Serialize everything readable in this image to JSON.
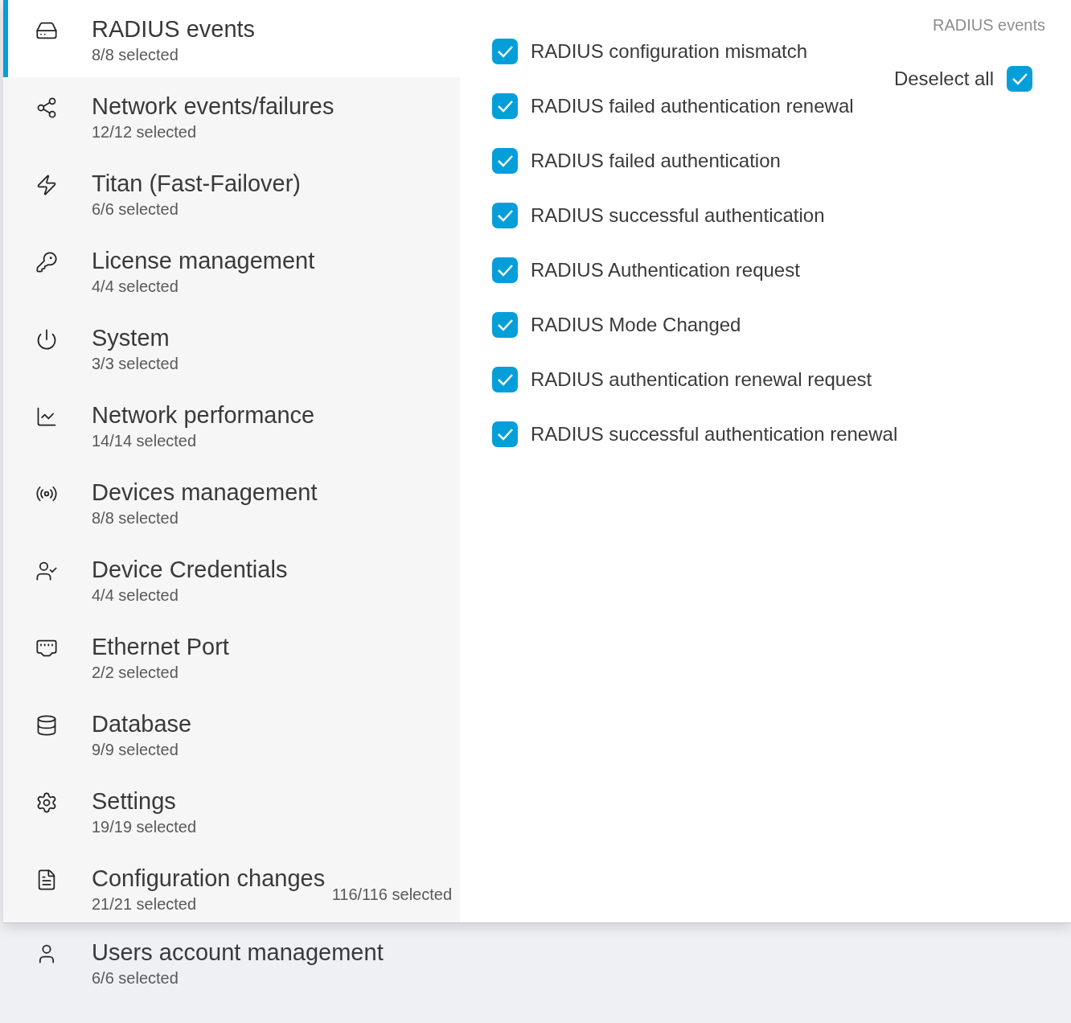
{
  "categories": [
    {
      "label": "RADIUS events",
      "count": "8/8 selected",
      "selected": true
    },
    {
      "label": "Network events/failures",
      "count": "12/12 selected",
      "selected": false
    },
    {
      "label": "Titan (Fast-Failover)",
      "count": "6/6 selected",
      "selected": false
    },
    {
      "label": "License management",
      "count": "4/4 selected",
      "selected": false
    },
    {
      "label": "System",
      "count": "3/3 selected",
      "selected": false
    },
    {
      "label": "Network performance",
      "count": "14/14 selected",
      "selected": false
    },
    {
      "label": "Devices management",
      "count": "8/8 selected",
      "selected": false
    },
    {
      "label": "Device Credentials",
      "count": "4/4 selected",
      "selected": false
    },
    {
      "label": "Ethernet Port",
      "count": "2/2 selected",
      "selected": false
    },
    {
      "label": "Database",
      "count": "9/9 selected",
      "selected": false
    },
    {
      "label": "Settings",
      "count": "19/19 selected",
      "selected": false
    },
    {
      "label": "Configuration changes",
      "count": "21/21 selected",
      "selected": false
    },
    {
      "label": "Users account management",
      "count": "6/6 selected",
      "selected": false
    }
  ],
  "total": "116/116 selected",
  "panel": {
    "title": "RADIUS events",
    "deselect_all": {
      "label": "Deselect all",
      "checked": true
    },
    "events": [
      {
        "label": "RADIUS configuration mismatch",
        "checked": true
      },
      {
        "label": "RADIUS failed authentication renewal",
        "checked": true
      },
      {
        "label": "RADIUS failed authentication",
        "checked": true
      },
      {
        "label": "RADIUS successful authentication",
        "checked": true
      },
      {
        "label": "RADIUS Authentication request",
        "checked": true
      },
      {
        "label": "RADIUS Mode Changed",
        "checked": true
      },
      {
        "label": "RADIUS authentication renewal request",
        "checked": true
      },
      {
        "label": "RADIUS successful authentication renewal",
        "checked": true
      }
    ]
  }
}
